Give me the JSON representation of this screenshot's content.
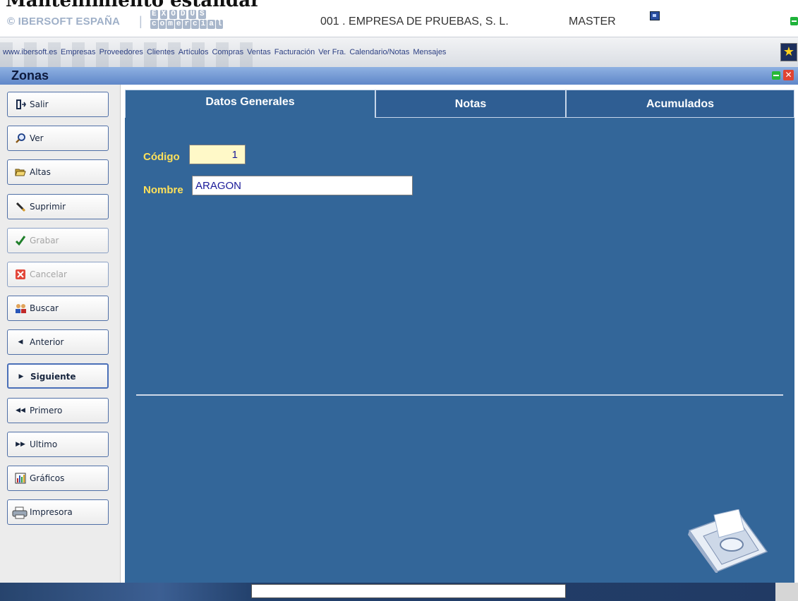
{
  "page_heading": "Mantenimiento estándar",
  "brand": {
    "company_prefix": "© IBERSOFT ESPAÑA",
    "separator": "|",
    "logo_top": [
      "E",
      "X",
      "O",
      "D",
      "U",
      "S"
    ],
    "logo_bottom": [
      "c",
      "o",
      "m",
      "e",
      "r",
      "c",
      "i",
      "a",
      "l"
    ],
    "company": "001 . EMPRESA DE PRUEBAS, S. L.",
    "user": "MASTER"
  },
  "menu": {
    "items": [
      "www.ibersoft.es",
      "Empresas",
      "Proveedores",
      "Clientes",
      "Artículos",
      "Compras",
      "Ventas",
      "Facturación",
      "Ver Fra.",
      "Calendario/Notas",
      "Mensajes"
    ]
  },
  "window": {
    "title": "Zonas"
  },
  "sidebar": {
    "buttons": [
      {
        "label": "Salir",
        "icon": "exit-door-icon"
      },
      {
        "label": "Ver",
        "icon": "magnifier-icon"
      },
      {
        "label": "Altas",
        "icon": "open-folder-icon"
      },
      {
        "label": "Suprimir",
        "icon": "eraser-icon"
      },
      {
        "label": "Grabar",
        "icon": "checkmark-icon"
      },
      {
        "label": "Cancelar",
        "icon": "cancel-x-icon"
      },
      {
        "label": "Buscar",
        "icon": "people-search-icon"
      },
      {
        "label": "Anterior",
        "icon": "triangle-left-icon"
      },
      {
        "label": "Siguiente",
        "icon": "triangle-right-icon"
      },
      {
        "label": "Primero",
        "icon": "double-left-icon"
      },
      {
        "label": "Ultimo",
        "icon": "double-right-icon"
      },
      {
        "label": "Gráficos",
        "icon": "bar-chart-icon"
      },
      {
        "label": "Impresora",
        "icon": "printer-icon"
      }
    ]
  },
  "tabs": [
    {
      "label": "Datos Generales",
      "selected": true
    },
    {
      "label": "Notas",
      "selected": false
    },
    {
      "label": "Acumulados",
      "selected": false
    }
  ],
  "form": {
    "codigo_label": "Código",
    "codigo_value": "1",
    "nombre_label": "Nombre",
    "nombre_value": "ARAGON"
  },
  "colors": {
    "panel_blue": "#336699",
    "label_yellow": "#ffe15a",
    "title_bar": "#6f95d4"
  }
}
